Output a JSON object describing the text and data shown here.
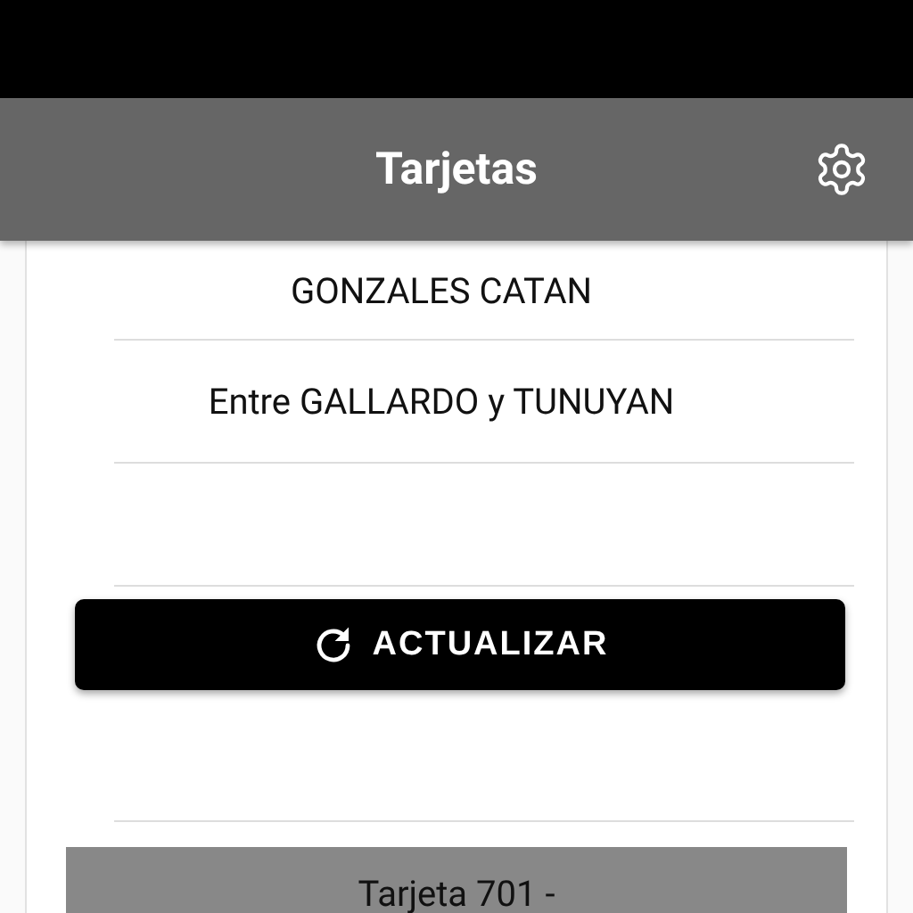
{
  "app_bar": {
    "title": "Tarjetas"
  },
  "details": [
    "GONZALES CATAN",
    "Entre GALLARDO y TUNUYAN"
  ],
  "refresh_button": {
    "label": "ACTUALIZAR"
  },
  "card_panel": {
    "title": "Tarjeta 701 -"
  }
}
